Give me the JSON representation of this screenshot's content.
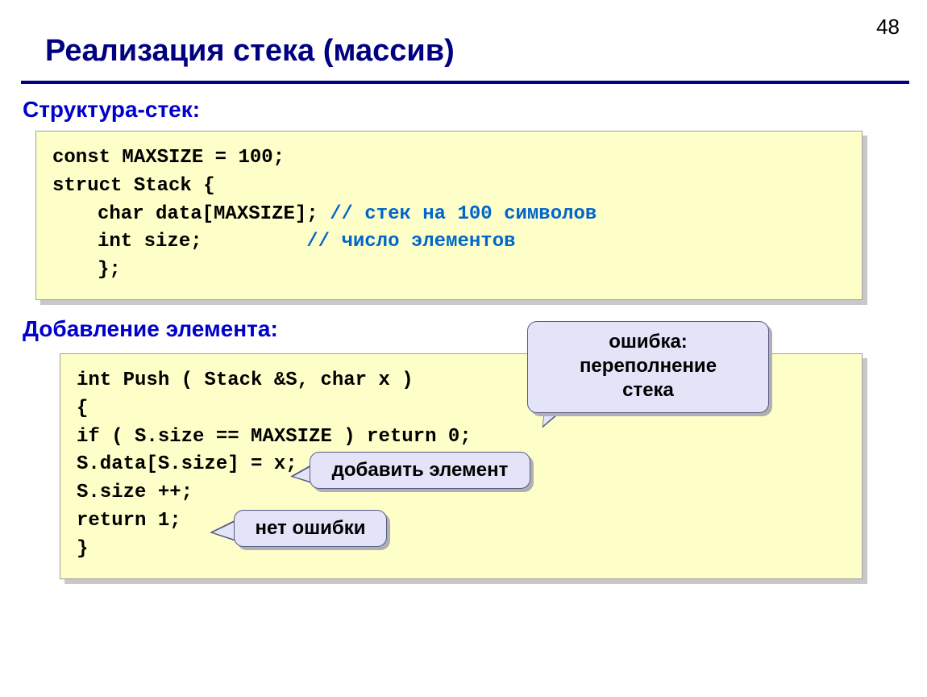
{
  "page_number": "48",
  "title": "Реализация стека (массив)",
  "section1_heading": "Структура-стек:",
  "section2_heading": "Добавление элемента:",
  "code1": {
    "l1_a": "const MAXSIZE = 100;",
    "l2_a": "struct Stack {",
    "l3_a": "char data[MAXSIZE];",
    "l3_c": "// стек на 100 символов",
    "l4_a": "int  size;",
    "l4_pad": "         ",
    "l4_c": "// число элементов",
    "l5_a": "};"
  },
  "code2": {
    "l1": "int Push ( Stack &S, char x )",
    "l2": "{",
    "l3": "if ( S.size == MAXSIZE ) return 0;",
    "l4": "S.data[S.size] = x;",
    "l5": "S.size ++;",
    "l6": "return 1;",
    "l7": "}"
  },
  "callouts": {
    "overflow_l1": "ошибка:",
    "overflow_l2": "переполнение",
    "overflow_l3": "стека",
    "add": "добавить элемент",
    "noerr": "нет ошибки"
  }
}
